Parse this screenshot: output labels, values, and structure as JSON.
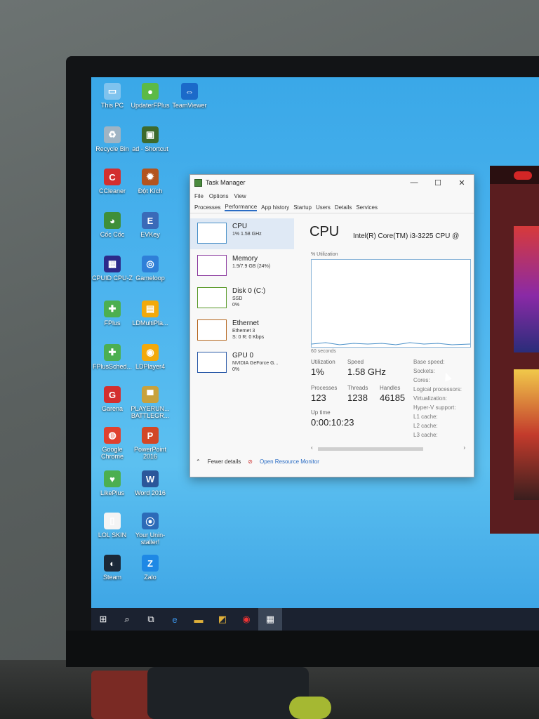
{
  "desktop_icons": [
    {
      "label": "This PC",
      "icon": "computer-icon",
      "glyph": "▭",
      "color": "#7fc3ee"
    },
    {
      "label": "UpdaterFPlus",
      "icon": "updater-icon",
      "glyph": "●",
      "color": "#5cba47"
    },
    {
      "label": "TeamViewer",
      "icon": "teamviewer-icon",
      "glyph": "⇔",
      "color": "#1b6ac9"
    },
    {
      "label": "Recycle Bin",
      "icon": "recycle-bin-icon",
      "glyph": "♻",
      "color": "#9fb4c4"
    },
    {
      "label": "ad - Shortcut",
      "icon": "shortcut-icon",
      "glyph": "▣",
      "color": "#3d6a2d"
    },
    {
      "label": "CCleaner",
      "icon": "ccleaner-icon",
      "glyph": "C",
      "color": "#d32f2f"
    },
    {
      "label": "Đột Kích",
      "icon": "crossfire-icon",
      "glyph": "✹",
      "color": "#b3541e"
    },
    {
      "label": "Cốc Cốc",
      "icon": "coccoc-icon",
      "glyph": "◕",
      "color": "#3f8f3a"
    },
    {
      "label": "EVKey",
      "icon": "evkey-icon",
      "glyph": "E",
      "color": "#3a6ab8"
    },
    {
      "label": "CPUID CPU-Z",
      "icon": "cpuz-icon",
      "glyph": "▦",
      "color": "#2c2a8a"
    },
    {
      "label": "Gameloop",
      "icon": "gameloop-icon",
      "glyph": "◎",
      "color": "#2f7fd8"
    },
    {
      "label": "FPlus",
      "icon": "fplus-icon",
      "glyph": "✚",
      "color": "#4caf50"
    },
    {
      "label": "LDMultiPla...",
      "icon": "ldmultiplayer-icon",
      "glyph": "▤",
      "color": "#f2a90b"
    },
    {
      "label": "FPlusSched...",
      "icon": "fplus-scheduler-icon",
      "glyph": "✚",
      "color": "#4caf50"
    },
    {
      "label": "LDPlayer4",
      "icon": "ldplayer-icon",
      "glyph": "◉",
      "color": "#f2a90b"
    },
    {
      "label": "Garena",
      "icon": "garena-icon",
      "glyph": "G",
      "color": "#d32f2f"
    },
    {
      "label": "PLAYERUN... BATTLEGR...",
      "icon": "pubg-icon",
      "glyph": "▀",
      "color": "#c9a23c"
    },
    {
      "label": "Google Chrome",
      "icon": "chrome-icon",
      "glyph": "◍",
      "color": "#e0412f"
    },
    {
      "label": "PowerPoint 2016",
      "icon": "powerpoint-icon",
      "glyph": "P",
      "color": "#d24726"
    },
    {
      "label": "LikePlus",
      "icon": "likeplus-icon",
      "glyph": "♥",
      "color": "#4caf50"
    },
    {
      "label": "Word 2016",
      "icon": "word-icon",
      "glyph": "W",
      "color": "#2b579a"
    },
    {
      "label": "LOL SKIN",
      "icon": "file-icon",
      "glyph": "▯",
      "color": "#f4f4f4"
    },
    {
      "label": "Your Unin-staller!",
      "icon": "uninstaller-icon",
      "glyph": "⦿",
      "color": "#2c6bb8"
    },
    {
      "label": "Steam",
      "icon": "steam-icon",
      "glyph": "◐",
      "color": "#1b2838"
    },
    {
      "label": "Zalo",
      "icon": "zalo-icon",
      "glyph": "Z",
      "color": "#1e88e5"
    }
  ],
  "task_manager": {
    "title": "Task Manager",
    "menu": [
      "File",
      "Options",
      "View"
    ],
    "tabs": [
      "Processes",
      "Performance",
      "App history",
      "Startup",
      "Users",
      "Details",
      "Services"
    ],
    "active_tab": "Performance",
    "window_controls": [
      "—",
      "☐",
      "✕"
    ],
    "resources": [
      {
        "name": "CPU",
        "sub1": "1% 1.58 GHz",
        "sub2": "",
        "color": "#4a90c8",
        "active": true
      },
      {
        "name": "Memory",
        "sub1": "1.9/7.9 GB (24%)",
        "sub2": "",
        "color": "#8b3a9e",
        "active": false
      },
      {
        "name": "Disk 0 (C:)",
        "sub1": "SSD",
        "sub2": "0%",
        "color": "#5a9a2a",
        "active": false
      },
      {
        "name": "Ethernet",
        "sub1": "Ethernet 3",
        "sub2": "S: 0 R: 0 Kbps",
        "color": "#b5651d",
        "active": false
      },
      {
        "name": "GPU 0",
        "sub1": "NVIDIA GeForce G...",
        "sub2": "0%",
        "color": "#2a5aa8",
        "active": false
      }
    ],
    "detail": {
      "heading": "CPU",
      "model": "Intel(R) Core(TM) i3-3225 CPU @",
      "util_label": "% Utilization",
      "seconds_label": "60 seconds",
      "utilization_label": "Utilization",
      "utilization": "1%",
      "speed_label": "Speed",
      "speed": "1.58 GHz",
      "processes_label": "Processes",
      "processes": "123",
      "threads_label": "Threads",
      "threads": "1238",
      "handles_label": "Handles",
      "handles": "46185",
      "uptime_label": "Up time",
      "uptime": "0:00:10:23",
      "specs": [
        "Base speed:",
        "Sockets:",
        "Cores:",
        "Logical processors:",
        "Virtualization:",
        "Hyper-V support:",
        "L1 cache:",
        "L2 cache:",
        "L3 cache:"
      ]
    },
    "fewer_details": "Fewer details",
    "open_monitor": "Open Resource Monitor",
    "scroll_left": "‹",
    "scroll_right": "›"
  },
  "taskbar": [
    {
      "name": "start-icon",
      "glyph": "⊞"
    },
    {
      "name": "search-icon",
      "glyph": "⌕"
    },
    {
      "name": "task-view-icon",
      "glyph": "⧉"
    },
    {
      "name": "edge-icon",
      "glyph": "e"
    },
    {
      "name": "file-explorer-icon",
      "glyph": "▬"
    },
    {
      "name": "store-icon",
      "glyph": "◩"
    },
    {
      "name": "garena-taskbar-icon",
      "glyph": "◉"
    },
    {
      "name": "task-manager-taskbar-icon",
      "glyph": "▦"
    }
  ]
}
